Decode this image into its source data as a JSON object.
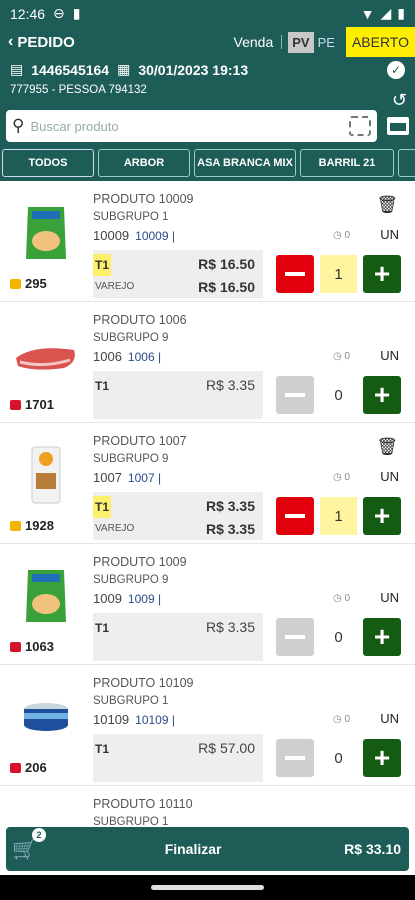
{
  "status": {
    "time": "12:46"
  },
  "header": {
    "back_label": "PEDIDO",
    "mode": "Venda",
    "pv": "PV",
    "pe": "PE",
    "state": "ABERTO"
  },
  "order": {
    "number": "1446545164",
    "datetime": "30/01/2023 19:13",
    "client": "777955 - PESSOA 794132"
  },
  "search": {
    "placeholder": "Buscar produto"
  },
  "tabs": [
    {
      "label": "TODOS"
    },
    {
      "label": "ARBOR"
    },
    {
      "label": "ASA BRANCA MIX"
    },
    {
      "label": "BARRIL 21"
    }
  ],
  "products": [
    {
      "name": "PRODUTO 10009",
      "subgroup": "SUBGRUPO 1",
      "code": "10009",
      "code2": "10009 |",
      "clock": "0",
      "unit": "UN",
      "stock": "295",
      "stock_color": "#f5b400",
      "tier": "T1",
      "price": "R$ 16.50",
      "variant": "VAREJO",
      "price2": "R$ 16.50",
      "qty": "1",
      "has_trash": true,
      "active": true,
      "image": "pouch-green"
    },
    {
      "name": "PRODUTO 1006",
      "subgroup": "SUBGRUPO 9",
      "code": "1006",
      "code2": "1006 |",
      "clock": "0",
      "unit": "UN",
      "stock": "1701",
      "stock_color": "#d4142a",
      "tier": "T1",
      "price": "R$ 3.35",
      "variant": "",
      "price2": "",
      "qty": "0",
      "has_trash": false,
      "active": false,
      "image": "meat"
    },
    {
      "name": "PRODUTO 1007",
      "subgroup": "SUBGRUPO 9",
      "code": "1007",
      "code2": "1007 |",
      "clock": "0",
      "unit": "UN",
      "stock": "1928",
      "stock_color": "#f5b400",
      "tier": "T1",
      "price": "R$ 3.35",
      "variant": "VAREJO",
      "price2": "R$ 3.35",
      "qty": "1",
      "has_trash": true,
      "active": true,
      "image": "pack-white"
    },
    {
      "name": "PRODUTO 1009",
      "subgroup": "SUBGRUPO 9",
      "code": "1009",
      "code2": "1009 |",
      "clock": "0",
      "unit": "UN",
      "stock": "1063",
      "stock_color": "#d4142a",
      "tier": "T1",
      "price": "R$ 3.35",
      "variant": "",
      "price2": "",
      "qty": "0",
      "has_trash": false,
      "active": false,
      "image": "pouch-green"
    },
    {
      "name": "PRODUTO 10109",
      "subgroup": "SUBGRUPO 1",
      "code": "10109",
      "code2": "10109 |",
      "clock": "0",
      "unit": "UN",
      "stock": "206",
      "stock_color": "#d4142a",
      "tier": "T1",
      "price": "R$ 57.00",
      "variant": "",
      "price2": "",
      "qty": "0",
      "has_trash": false,
      "active": false,
      "image": "can"
    },
    {
      "name": "PRODUTO 10110",
      "subgroup": "SUBGRUPO 1",
      "code": "",
      "code2": "",
      "clock": "",
      "unit": "",
      "stock": "",
      "stock_color": "#d4142a",
      "tier": "",
      "price": "",
      "variant": "",
      "price2": "",
      "qty": "",
      "has_trash": false,
      "active": false,
      "image": ""
    }
  ],
  "footer": {
    "cart_count": "2",
    "action": "Finalizar",
    "total": "R$ 33.10"
  },
  "colors": {
    "primary": "#1e5d57",
    "open_badge": "#ffee00",
    "minus": "#e3000d",
    "plus": "#145c14"
  }
}
